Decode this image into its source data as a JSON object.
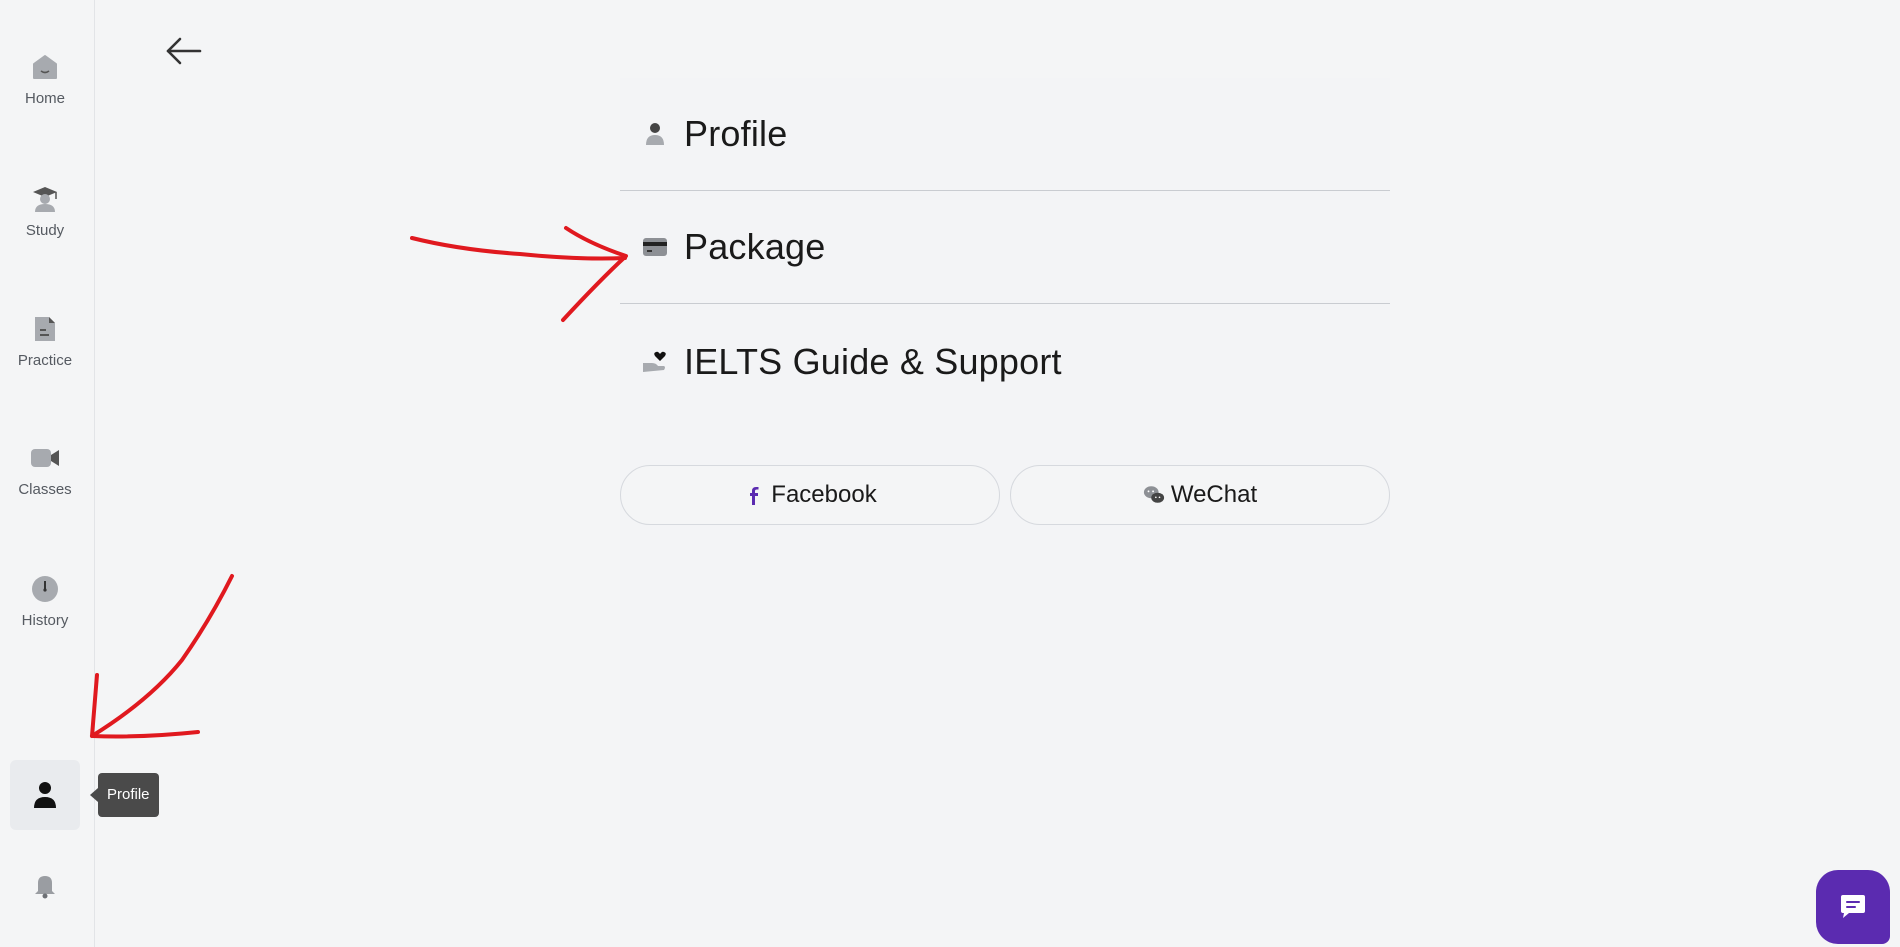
{
  "sidebar": {
    "items": [
      {
        "label": "Home",
        "icon": "home-icon"
      },
      {
        "label": "Study",
        "icon": "graduation-cap-icon"
      },
      {
        "label": "Practice",
        "icon": "document-icon"
      },
      {
        "label": "Classes",
        "icon": "video-camera-icon"
      },
      {
        "label": "History",
        "icon": "clock-icon"
      }
    ],
    "profile_icon": "person-icon",
    "bell_icon": "bell-icon",
    "tooltip": "Profile"
  },
  "menu": {
    "items": [
      {
        "label": "Profile",
        "icon": "person-icon"
      },
      {
        "label": "Package",
        "icon": "credit-card-icon"
      },
      {
        "label": "IELTS Guide & Support",
        "icon": "hand-heart-icon"
      }
    ]
  },
  "social": {
    "facebook_label": "Facebook",
    "wechat_label": "WeChat"
  },
  "colors": {
    "accent": "#5b2bb0",
    "annotation": "#e0191f",
    "background": "#f4f5f6"
  }
}
